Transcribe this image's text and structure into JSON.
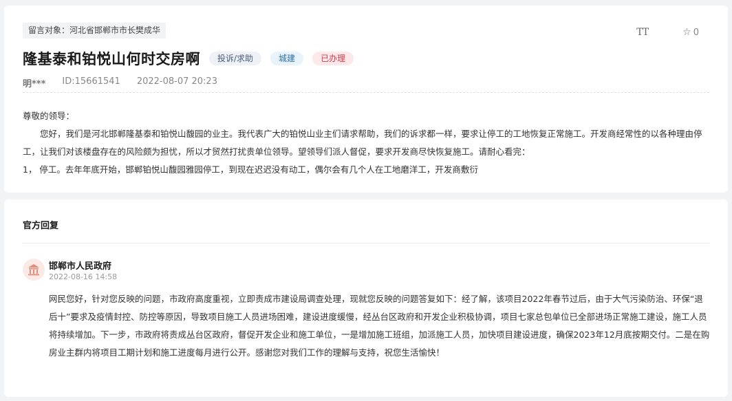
{
  "message": {
    "target_label": "留言对象：河北省邯郸市市长樊成华",
    "font_toggle": "TT",
    "favorite_count": "0",
    "title": "隆基泰和铂悦山何时交房啊",
    "tags": {
      "type": "投诉/求助",
      "category": "城建",
      "status": "已办理"
    },
    "author": "明***",
    "id_text": "ID:15661541",
    "datetime": "2022-08-07 20:23",
    "paragraphs": [
      "尊敬的领导：",
      "您好，我们是河北邯郸隆基泰和铂悦山馥园的业主。我代表广大的铂悦山业主们请求帮助，我们的诉求都一样，要求让停工的工地恢复正常施工。开发商经常性的以各种理由停工，让我们对该楼盘存在的风险颇为担忧，所以才贸然打扰贵单位领导。望领导们派人督促，要求开发商尽快恢复施工。请耐心看完：",
      "1，  停工。去年年底开始，邯郸铂悦山馥园雅园停工，到现在迟迟没有动工，偶尔会有几个人在工地磨洋工，开发商敷衍"
    ]
  },
  "reply": {
    "heading": "官方回复",
    "org": "邯郸市人民政府",
    "time": "2022-08-16 14:58",
    "content": "网民您好，针对您反映的问题，市政府高度重视，立即责成市建设局调查处理，现就您反映的问题答复如下：经了解，该项目2022年春节过后，由于大气污染防治、环保“退后十”要求及疫情封控、防控等原因，导致项目施工人员进场困难，建设进度缓慢，经丛台区政府和开发企业积极协调，项目七家总包单位已全部进场正常施工建设，施工人员将持续增加。下一步，市政府将责成丛台区政府，督促开发企业和施工单位，一是增加施工班组，加派施工人员，加快项目建设进度，确保2023年12月底按期交付。二是在购房业主群内将项目工期计划和施工进度每月进行公开。感谢您对我们工作的理解与支持，祝您生活愉快！"
  },
  "colors": {
    "status_red": "#d83b4a",
    "category_blue": "#2e6fa8",
    "avatar_bg": "#fbe9e6",
    "avatar_icon": "#e8897a"
  },
  "icons": [
    "font-size-icon",
    "star-icon",
    "government-building-icon"
  ]
}
